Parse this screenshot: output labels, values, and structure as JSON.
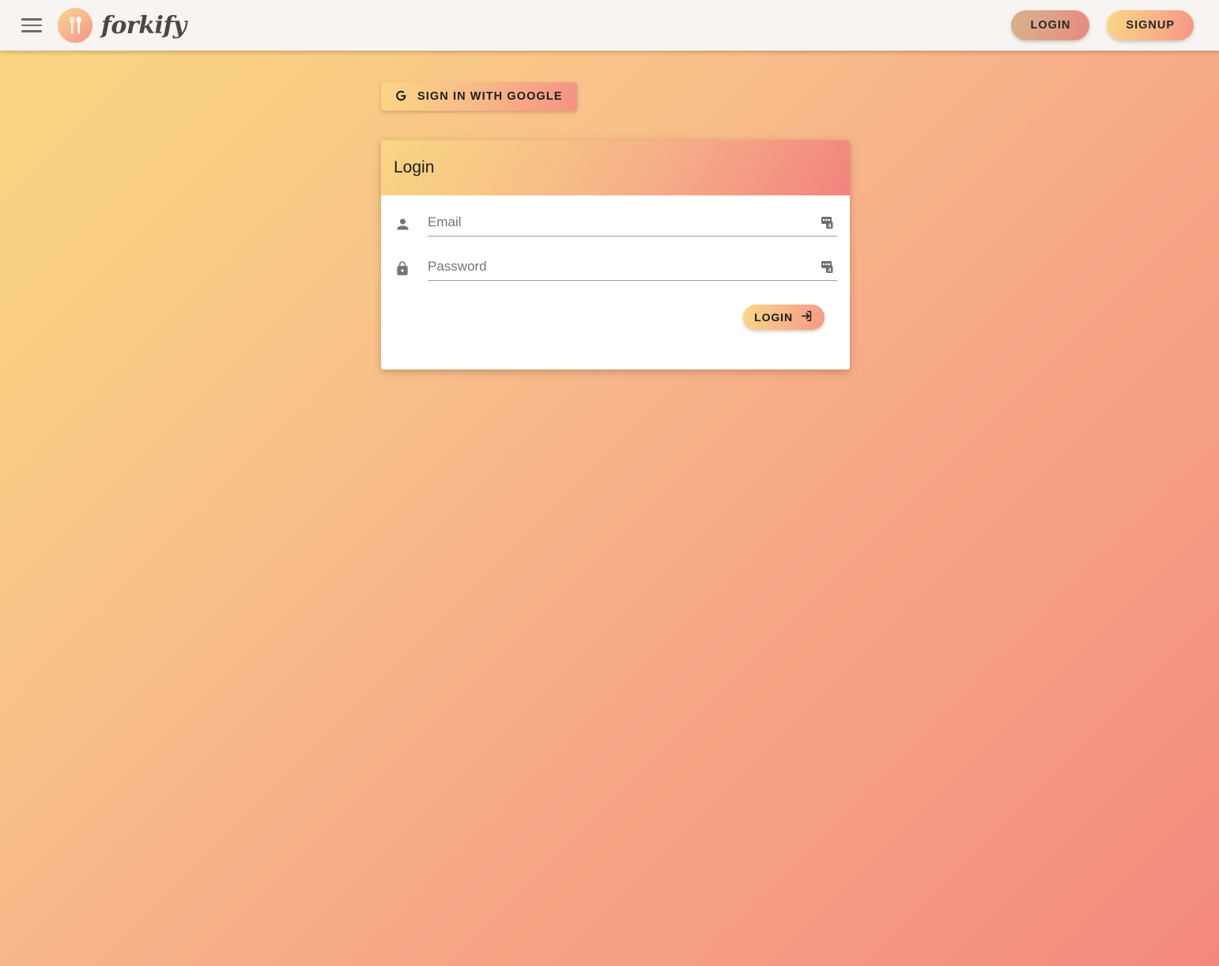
{
  "navbar": {
    "menu_icon": "hamburger-menu-icon",
    "logo_icon": "fork-spoon-logo-icon",
    "brand_name": "forkify",
    "login_label": "LOGIN",
    "signup_label": "SIGNUP"
  },
  "google": {
    "icon": "google-g-icon",
    "label": "SIGN IN WITH GOOGLE"
  },
  "card": {
    "title": "Login",
    "email": {
      "icon": "person-icon",
      "placeholder": "Email",
      "value": "",
      "autofill_icon": "autofill-badge-icon"
    },
    "password": {
      "icon": "lock-icon",
      "placeholder": "Password",
      "value": "",
      "autofill_icon": "autofill-badge-icon"
    },
    "submit": {
      "label": "LOGIN",
      "icon": "login-arrow-icon"
    }
  },
  "colors": {
    "background_start": "#f9d681",
    "background_end": "#f4887f",
    "navbar_bg": "#f7f4f1",
    "accent_yellow": "#fad787",
    "accent_salmon": "#f4887f",
    "brand_text": "#4f453f",
    "placeholder": "#757575"
  }
}
